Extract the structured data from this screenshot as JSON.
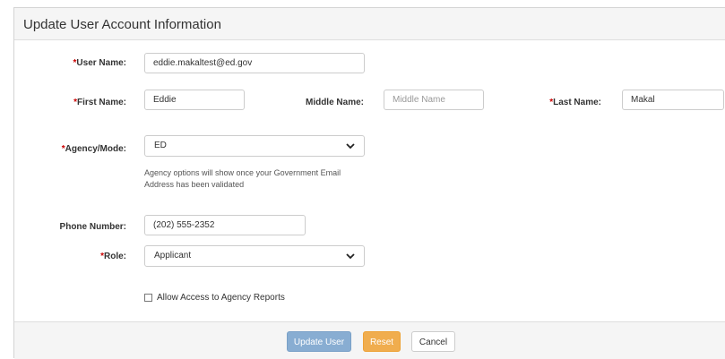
{
  "header": {
    "title": "Update User Account Information"
  },
  "required_marker": "*",
  "form": {
    "user_name": {
      "label": "User Name:",
      "value": "eddie.makaltest@ed.gov"
    },
    "first_name": {
      "label": "First Name:",
      "value": "Eddie"
    },
    "middle_name": {
      "label": "Middle Name:",
      "value": "",
      "placeholder": "Middle Name"
    },
    "last_name": {
      "label": "Last Name:",
      "value": "Makal"
    },
    "agency": {
      "label": "Agency/Mode:",
      "value": "ED",
      "help": "Agency options will show once your Government Email Address has been validated"
    },
    "phone": {
      "label": "Phone Number:",
      "value": "(202) 555-2352"
    },
    "role": {
      "label": "Role:",
      "value": "Applicant"
    },
    "agency_reports": {
      "label": "Allow Access to Agency Reports",
      "checked": false
    }
  },
  "footer": {
    "update_label": "Update User",
    "reset_label": "Reset",
    "cancel_label": "Cancel"
  },
  "colors": {
    "primary": "#88add2",
    "warning": "#f0ad4e",
    "required": "#cc0000"
  }
}
